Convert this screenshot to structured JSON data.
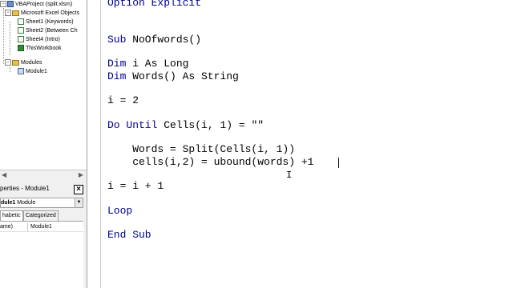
{
  "project_explorer": {
    "tree": [
      {
        "label": "VBAProject (split.xlsm)",
        "icon": "vba-project-icon"
      },
      {
        "label": "Microsoft Excel Objects",
        "icon": "folder-icon"
      },
      {
        "label": "Sheet1 (Keywords)",
        "icon": "worksheet-icon"
      },
      {
        "label": "Sheet2 (Between Ch",
        "icon": "worksheet-icon"
      },
      {
        "label": "Sheet4 (Intro)",
        "icon": "worksheet-icon"
      },
      {
        "label": "ThisWorkbook",
        "icon": "workbook-icon"
      },
      {
        "label": "Modules",
        "icon": "folder-icon"
      },
      {
        "label": "Module1",
        "icon": "module-icon"
      }
    ]
  },
  "properties": {
    "title": "perties - Module1",
    "object_name": "dule1",
    "object_type": "Module",
    "tabs": [
      "habetic",
      "Categorized"
    ],
    "row_name": "ame)",
    "row_value": "Module1"
  },
  "code": {
    "lines": [
      {
        "text": "Option Explicit",
        "keyword": "Option Explicit",
        "rest": ""
      },
      {
        "text": "Sub NoOfwords()",
        "keyword": "Sub",
        "rest": " NoOfwords()"
      },
      {
        "text": "Dim i As Long",
        "keyword": "Dim",
        "rest": " i As Long"
      },
      {
        "text": "Dim Words() As String",
        "keyword": "Dim",
        "rest": " Words() As String"
      },
      {
        "text": "i = 2",
        "keyword": "",
        "rest": "i = 2"
      },
      {
        "text": "Do Until Cells(i, 1) = \"\"",
        "keyword": "Do Until",
        "rest": " Cells(i, 1) = \"\""
      },
      {
        "text": "    Words = Split(Cells(i, 1))",
        "keyword": "",
        "rest": "    Words = Split(Cells(i, 1))"
      },
      {
        "text": "    cells(i,2) = ubound(words) +1",
        "keyword": "",
        "rest": "    cells(i,2) = ubound(words) +1"
      },
      {
        "text": "i = i + 1",
        "keyword": "",
        "rest": "i = i + 1"
      },
      {
        "text": "Loop",
        "keyword": "Loop",
        "rest": ""
      },
      {
        "text": "End Sub",
        "keyword": "End Sub",
        "rest": ""
      }
    ]
  }
}
